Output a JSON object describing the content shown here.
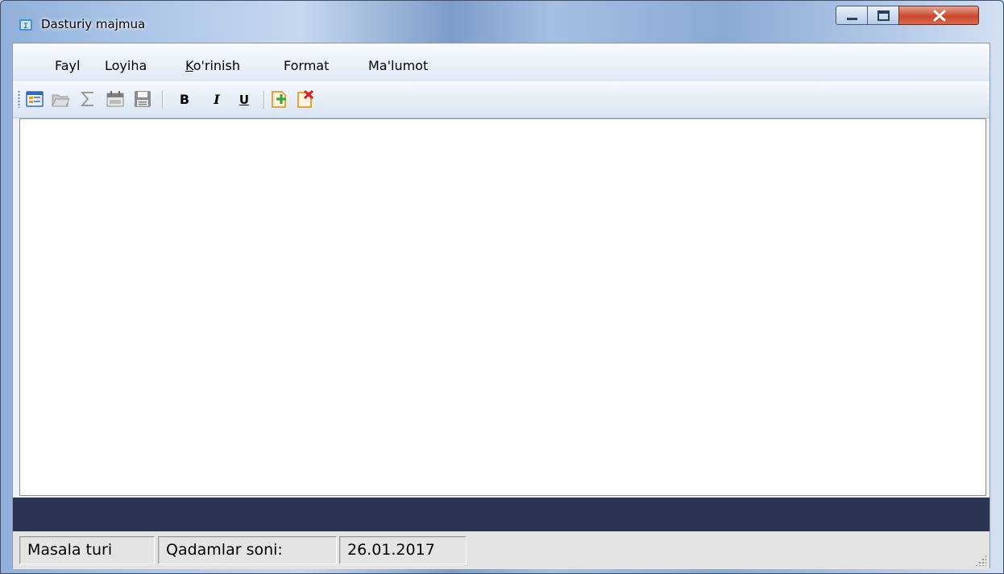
{
  "window": {
    "title": "Dasturiy majmua",
    "controls": {
      "minimize": "minimize-icon",
      "maximize": "maximize-icon",
      "close": "close-icon"
    }
  },
  "menu": {
    "items": [
      {
        "label": "Fayl"
      },
      {
        "label": "Loyiha"
      },
      {
        "label_underlined": "K",
        "label_rest": "o'rinish"
      },
      {
        "label": "Format"
      },
      {
        "label": "Ma'lumot"
      }
    ]
  },
  "toolbar": {
    "buttons": [
      "new-form-icon",
      "open-folder-icon",
      "sigma-icon",
      "calendar-icon",
      "save-icon"
    ],
    "bold_label": "B",
    "italic_label": "I",
    "underline_label": "U",
    "add_icon": "add-document-icon",
    "delete_icon": "delete-document-icon"
  },
  "editor": {
    "content": ""
  },
  "status": {
    "task_type": "Masala turi",
    "steps": "Qadamlar soni:",
    "date": "26.01.2017"
  },
  "colors": {
    "dark_bar": "#2a3651",
    "close_button": "#c8492f",
    "add_icon_green": "#3aa53a",
    "delete_icon_red": "#d92020",
    "document_orange": "#f0a030"
  }
}
